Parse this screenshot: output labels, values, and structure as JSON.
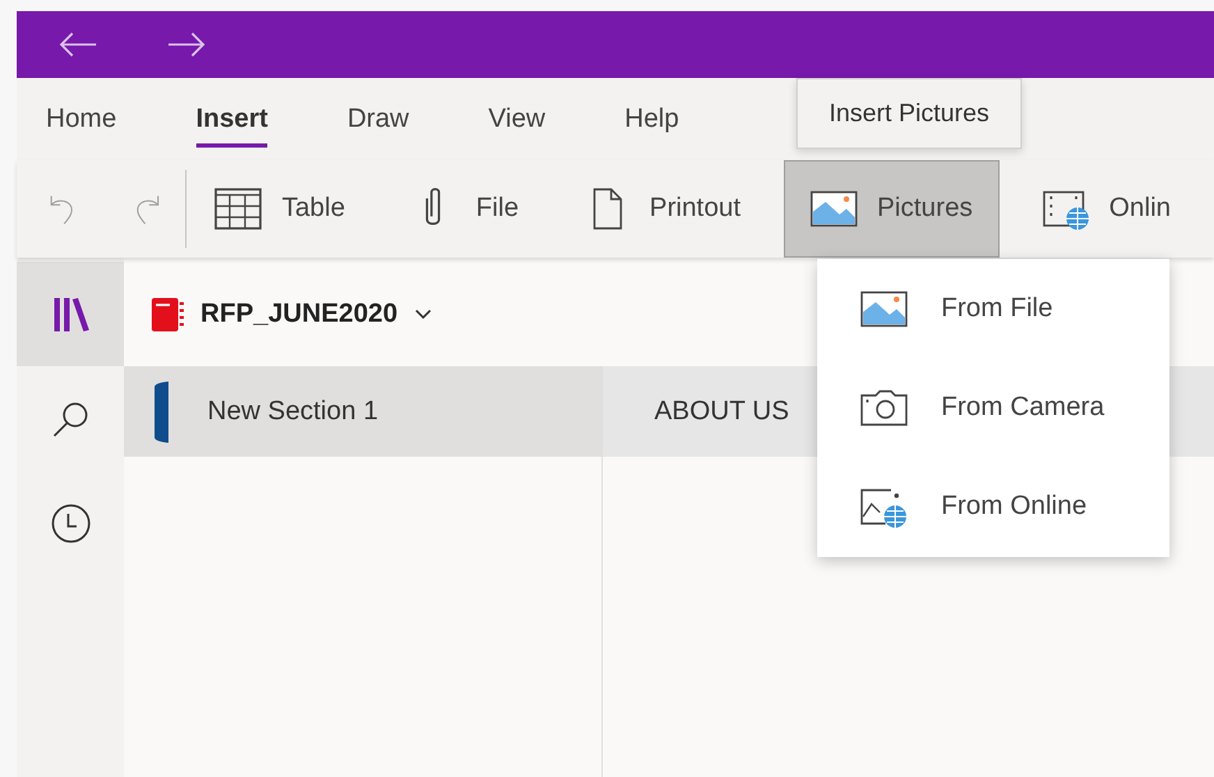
{
  "ribbon_tabs": [
    {
      "label": "Home",
      "selected": false
    },
    {
      "label": "Insert",
      "selected": true
    },
    {
      "label": "Draw",
      "selected": false
    },
    {
      "label": "View",
      "selected": false
    },
    {
      "label": "Help",
      "selected": false
    }
  ],
  "toolbar": [
    {
      "kind": "table",
      "label": "Table",
      "pressed": false
    },
    {
      "kind": "file",
      "label": "File",
      "pressed": false
    },
    {
      "kind": "printout",
      "label": "Printout",
      "pressed": false
    },
    {
      "kind": "pictures",
      "label": "Pictures",
      "pressed": true
    },
    {
      "kind": "online",
      "label": "Onlin",
      "pressed": false
    }
  ],
  "tooltip": "Insert Pictures",
  "pictures_menu": [
    {
      "kind": "file",
      "label": "From File"
    },
    {
      "kind": "camera",
      "label": "From Camera"
    },
    {
      "kind": "online",
      "label": "From Online"
    }
  ],
  "rail": [
    {
      "kind": "notebooks",
      "selected": true
    },
    {
      "kind": "search",
      "selected": false
    },
    {
      "kind": "recent",
      "selected": false
    }
  ],
  "notebook": {
    "name": "RFP_JUNE2020"
  },
  "sections": [
    {
      "label": "New Section 1",
      "selected": true,
      "color": "#0f4c8c"
    }
  ],
  "pages": [
    {
      "label": "ABOUT US",
      "selected": true
    }
  ]
}
